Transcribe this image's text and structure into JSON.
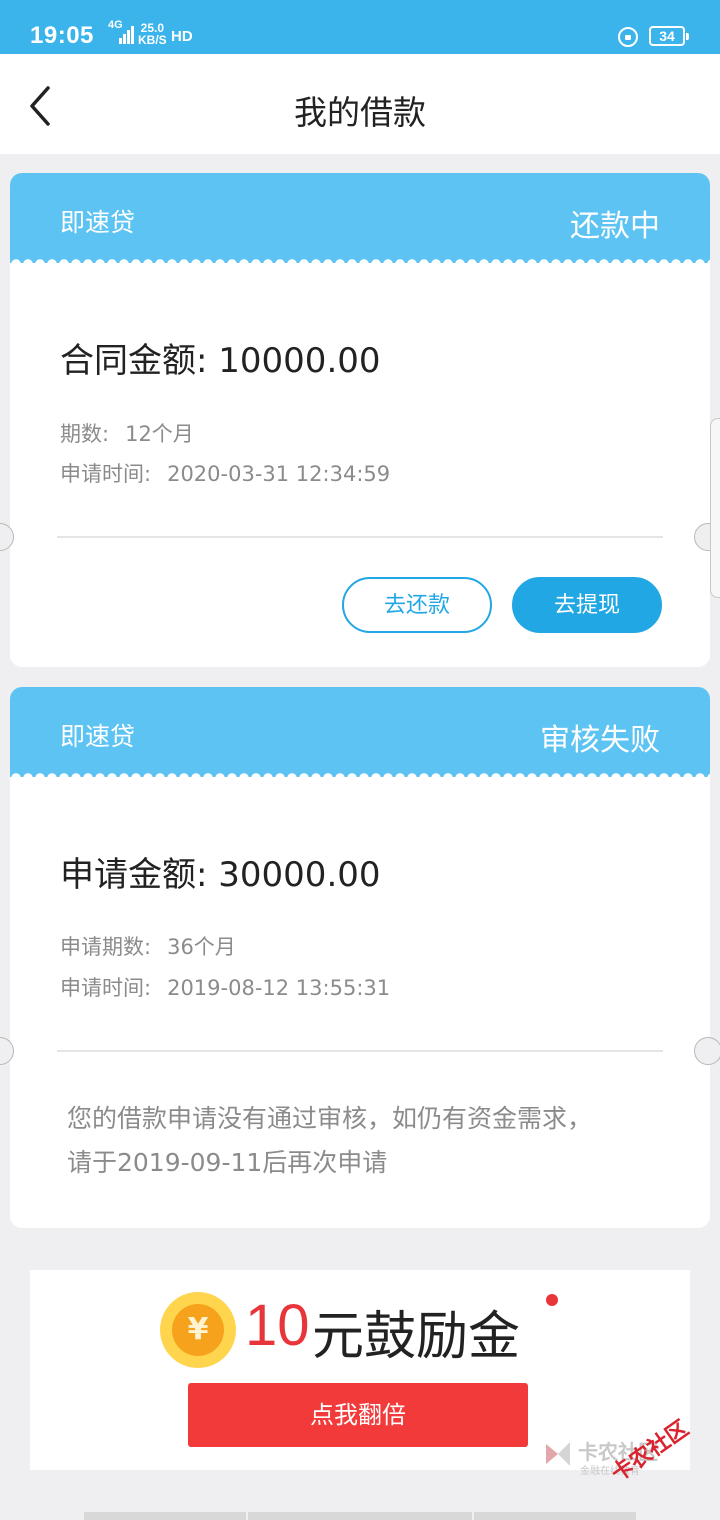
{
  "status_bar": {
    "time": "19:05",
    "network": "4G",
    "speed_value": "25.0",
    "speed_unit": "KB/S",
    "hd": "HD",
    "battery": "34"
  },
  "nav": {
    "title": "我的借款",
    "back_icon": "chevron-left-icon"
  },
  "loans": [
    {
      "product": "即速贷",
      "status": "还款中",
      "amount_label": "合同金额:",
      "amount_value": "10000.00",
      "term_label": "期数:",
      "term_value": "12个月",
      "time_label": "申请时间:",
      "time_value": "2020-03-31 12:34:59",
      "buttons": [
        "去还款",
        "去提现"
      ]
    },
    {
      "product": "即速贷",
      "status": "审核失败",
      "amount_label": "申请金额:",
      "amount_value": "30000.00",
      "term_label": "申请期数:",
      "term_value": "36个月",
      "time_label": "申请时间:",
      "time_value": "2019-08-12 13:55:31",
      "message_line1": "您的借款申请没有通过审核，如仍有资金需求，",
      "message_line2": "请于2019-09-11后再次申请"
    }
  ],
  "promo": {
    "coin_symbol": "¥",
    "amount": "10",
    "text": "元鼓励金",
    "button": "点我翻倍"
  },
  "watermark": {
    "title": "卡农社区",
    "subtitle": "金融在线教育",
    "stamp": "卡农社区"
  },
  "colors": {
    "status_bar": "#3bb4ec",
    "card_header": "#5cc3f3",
    "accent": "#22a7e5",
    "promo_red": "#f23a3a"
  }
}
